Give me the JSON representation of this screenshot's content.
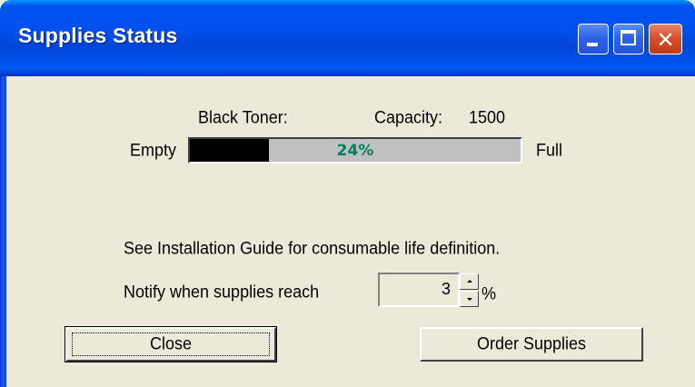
{
  "window": {
    "title": "Supplies Status"
  },
  "titlebar_buttons": {
    "minimize": "minimize-icon",
    "maximize": "maximize-icon",
    "close": "close-icon",
    "close_glyph": "✕"
  },
  "supply": {
    "name": "Black Toner:",
    "capacity_label": "Capacity:",
    "capacity_value": "1500",
    "empty_label": "Empty",
    "full_label": "Full",
    "percent_text": "24%",
    "level_fraction": 0.24
  },
  "info": {
    "guide_text": "See Installation Guide for consumable life definition.",
    "notify_label": "Notify when supplies reach",
    "notify_value": "3",
    "percent_sign": "%"
  },
  "buttons": {
    "close": "Close",
    "order": "Order Supplies"
  },
  "colors": {
    "window_bg": "#ECE9D8",
    "titlebar_blue": "#0054E3",
    "progress_fill": "#000000",
    "progress_track": "#C0C0C0",
    "percent_text": "#008060",
    "close_red": "#D9512E"
  }
}
